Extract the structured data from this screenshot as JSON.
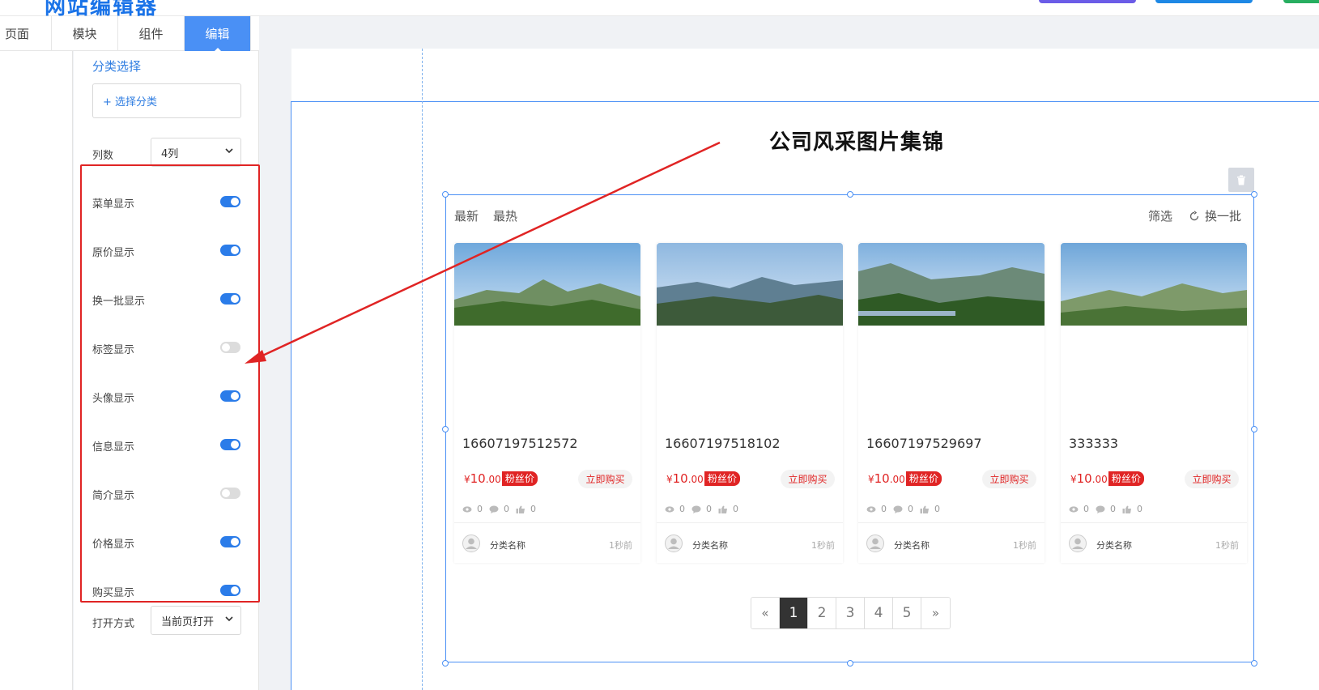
{
  "app": {
    "logo_text": "网站编辑器"
  },
  "tabs": [
    {
      "label": "页面"
    },
    {
      "label": "模块"
    },
    {
      "label": "组件"
    },
    {
      "label": "编辑"
    }
  ],
  "panel": {
    "section_title": "分类选择",
    "select_category": "+ 选择分类",
    "columns_label": "列数",
    "columns_value": "4列",
    "toggles": [
      {
        "label": "菜单显示",
        "on": true
      },
      {
        "label": "原价显示",
        "on": true
      },
      {
        "label": "换一批显示",
        "on": true
      },
      {
        "label": "标签显示",
        "on": false
      },
      {
        "label": "头像显示",
        "on": true
      },
      {
        "label": "信息显示",
        "on": true
      },
      {
        "label": "简介显示",
        "on": false
      },
      {
        "label": "价格显示",
        "on": true
      },
      {
        "label": "购买显示",
        "on": true
      }
    ],
    "open_mode_label": "打开方式",
    "open_mode_value": "当前页打开"
  },
  "canvas": {
    "heading": "公司风采图片集锦",
    "filters_left": [
      "最新",
      "最热"
    ],
    "filter": "筛选",
    "refresh": "换一批",
    "cards": [
      {
        "title": "16607197512572",
        "currency": "¥",
        "price_int": "10",
        "price_dec": ".00",
        "fan_tag": "粉丝价",
        "buy": "立即购买",
        "views": "0",
        "comments": "0",
        "likes": "0",
        "category": "分类名称",
        "time": "1秒前"
      },
      {
        "title": "16607197518102",
        "currency": "¥",
        "price_int": "10",
        "price_dec": ".00",
        "fan_tag": "粉丝价",
        "buy": "立即购买",
        "views": "0",
        "comments": "0",
        "likes": "0",
        "category": "分类名称",
        "time": "1秒前"
      },
      {
        "title": "16607197529697",
        "currency": "¥",
        "price_int": "10",
        "price_dec": ".00",
        "fan_tag": "粉丝价",
        "buy": "立即购买",
        "views": "0",
        "comments": "0",
        "likes": "0",
        "category": "分类名称",
        "time": "1秒前"
      },
      {
        "title": "333333",
        "currency": "¥",
        "price_int": "10",
        "price_dec": ".00",
        "fan_tag": "粉丝价",
        "buy": "立即购买",
        "views": "0",
        "comments": "0",
        "likes": "0",
        "category": "分类名称",
        "time": "1秒前"
      }
    ],
    "pagination": {
      "prev": "«",
      "pages": [
        "1",
        "2",
        "3",
        "4",
        "5"
      ],
      "current": "1",
      "next": "»"
    }
  },
  "colors": {
    "accent": "#4a90f5",
    "link_blue": "#2f7de1",
    "toggle_on": "#2b7ce9",
    "highlight_red": "#e02424"
  }
}
